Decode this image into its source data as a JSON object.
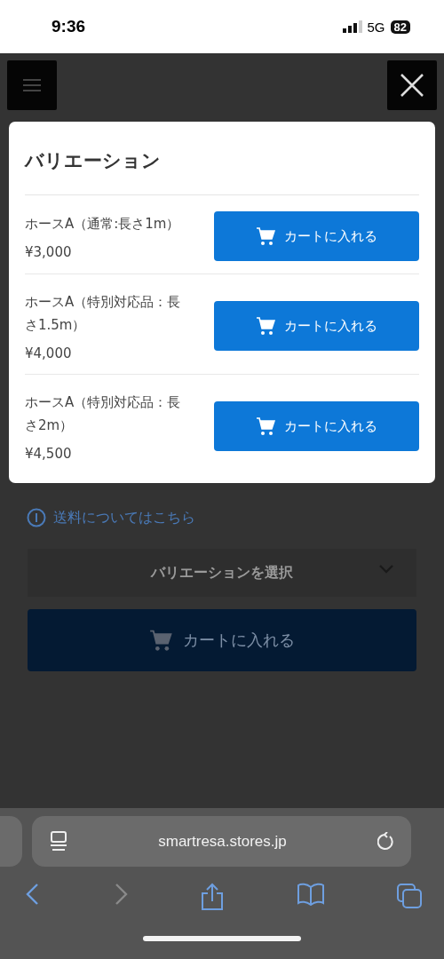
{
  "status_bar": {
    "time": "9:36",
    "network": "5G",
    "battery": "82"
  },
  "modal": {
    "title": "バリエーション",
    "items": [
      {
        "name": "ホースA（通常:長さ1m）",
        "price": "¥3,000",
        "button": "カートに入れる"
      },
      {
        "name": "ホースA（特別対応品：長さ1.5m）",
        "price": "¥4,000",
        "button": "カートに入れる"
      },
      {
        "name": "ホースA（特別対応品：長さ2m）",
        "price": "¥4,500",
        "button": "カートに入れる"
      }
    ]
  },
  "page": {
    "shipping_link": "送料についてはこちら",
    "variation_select": "バリエーションを選択",
    "cart_button": "カートに入れる"
  },
  "browser": {
    "url": "smartresa.stores.jp",
    "nav": [
      {
        "kind": "back",
        "disabled": false
      },
      {
        "kind": "forward",
        "disabled": true
      },
      {
        "kind": "share",
        "disabled": false
      },
      {
        "kind": "bookmarks",
        "disabled": false
      },
      {
        "kind": "tabs",
        "disabled": false
      }
    ]
  }
}
